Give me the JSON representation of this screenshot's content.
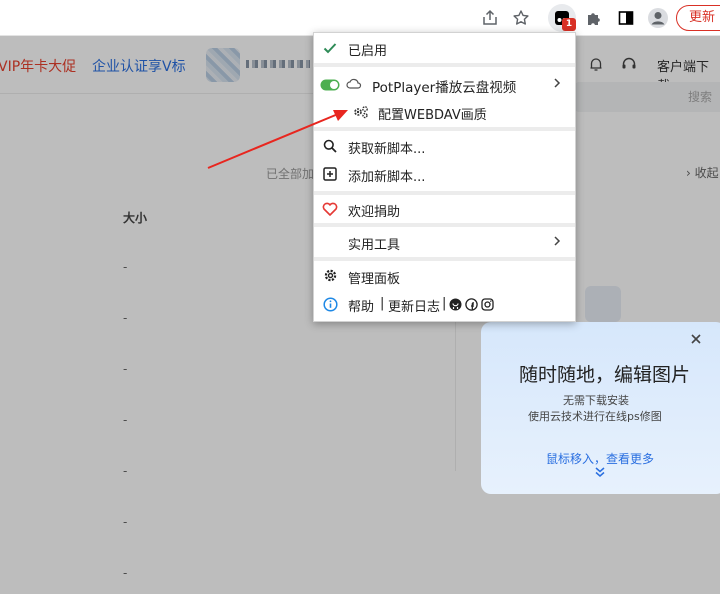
{
  "browser": {
    "update_label": "更新",
    "extension_badge": "1",
    "icons": [
      "share-icon",
      "star-icon",
      "tampermonkey-icon",
      "puzzle-icon",
      "side-panel-icon",
      "profile-icon"
    ]
  },
  "nav": {
    "promo1": "VIP年卡大促",
    "promo2": "企业认证享V标",
    "client_download": "客户端下载"
  },
  "content": {
    "search_placeholder": "搜索",
    "loaded_all": "已全部加",
    "collect_more": "收起",
    "size_header": "大小",
    "rows": [
      "-",
      "-",
      "-",
      "-",
      "-",
      "-",
      "-"
    ]
  },
  "promo_card": {
    "title": "随时随地，编辑图片",
    "sub1": "无需下载安装",
    "sub2": "使用云技术进行在线ps修图",
    "link": "鼠标移入，查看更多"
  },
  "menu": {
    "enabled": "已启用",
    "script_name": "PotPlayer播放云盘视频",
    "configure": "配置WEBDAV画质",
    "get_new": "获取新脚本...",
    "add_new": "添加新脚本...",
    "donate": "欢迎捐助",
    "tools": "实用工具",
    "dashboard": "管理面板",
    "help": "帮助",
    "changelog": "更新日志",
    "sep": "|",
    "colors": {
      "check": "#2e8b57",
      "toggle": "#4caf50",
      "heart": "#e53935",
      "info": "#1e88e5"
    }
  },
  "annotation": {
    "color": "#e8261f"
  }
}
